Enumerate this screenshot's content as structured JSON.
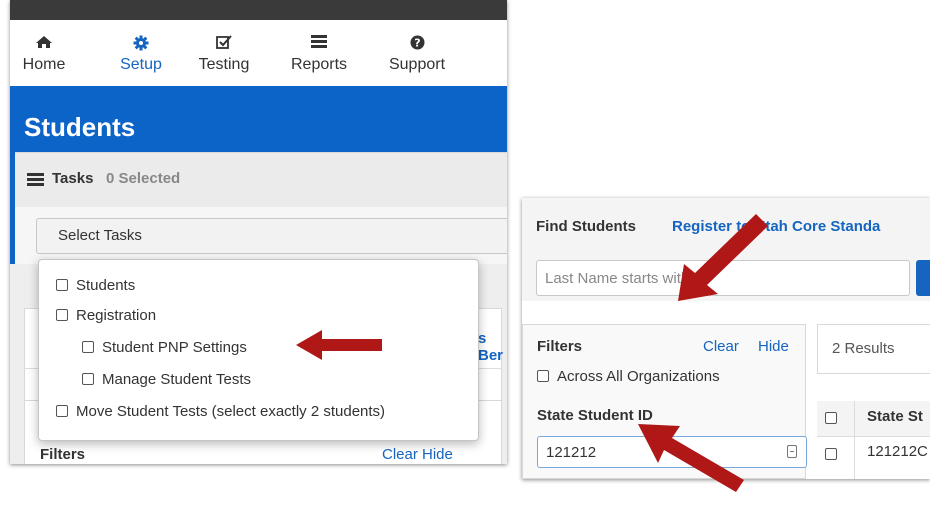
{
  "left": {
    "nav": [
      {
        "label": "Home",
        "icon": "home-icon",
        "active": false
      },
      {
        "label": "Setup",
        "icon": "gear-icon",
        "active": true
      },
      {
        "label": "Testing",
        "icon": "checkbox-icon",
        "active": false
      },
      {
        "label": "Reports",
        "icon": "list-icon",
        "active": false
      },
      {
        "label": "Support",
        "icon": "help-icon",
        "active": false
      }
    ],
    "page_title": "Students",
    "tasks": {
      "label": "Tasks",
      "count_text": "0 Selected",
      "select_label": "Select Tasks"
    },
    "dropdown_items": [
      {
        "label": "Students",
        "checked": false
      },
      {
        "label": "Registration",
        "checked": false
      },
      {
        "label": "Student PNP Settings",
        "checked": false
      },
      {
        "label": "Manage Student Tests",
        "checked": false
      },
      {
        "label": "Move Student Tests (select exactly 2 students)",
        "checked": false
      }
    ],
    "partial_text_right": "s Ber",
    "filters_label": "Filters",
    "clear_hide": "Clear  Hide"
  },
  "right": {
    "find_title": "Find Students",
    "register_link": "Register to Utah Core Standa",
    "search_placeholder": "Last Name starts with",
    "filters_title": "Filters",
    "clear_label": "Clear",
    "hide_label": "Hide",
    "across_all_orgs": "Across All Organizations",
    "ssid_label": "State Student ID",
    "ssid_value": "121212",
    "results_count": "2 Results",
    "table_header": "State St",
    "table_cell": "121212C"
  },
  "colors": {
    "brand_blue": "#0c63c8",
    "link_blue": "#1565c0",
    "arrow_red": "#b01818",
    "topbar": "#3a3a3a"
  }
}
